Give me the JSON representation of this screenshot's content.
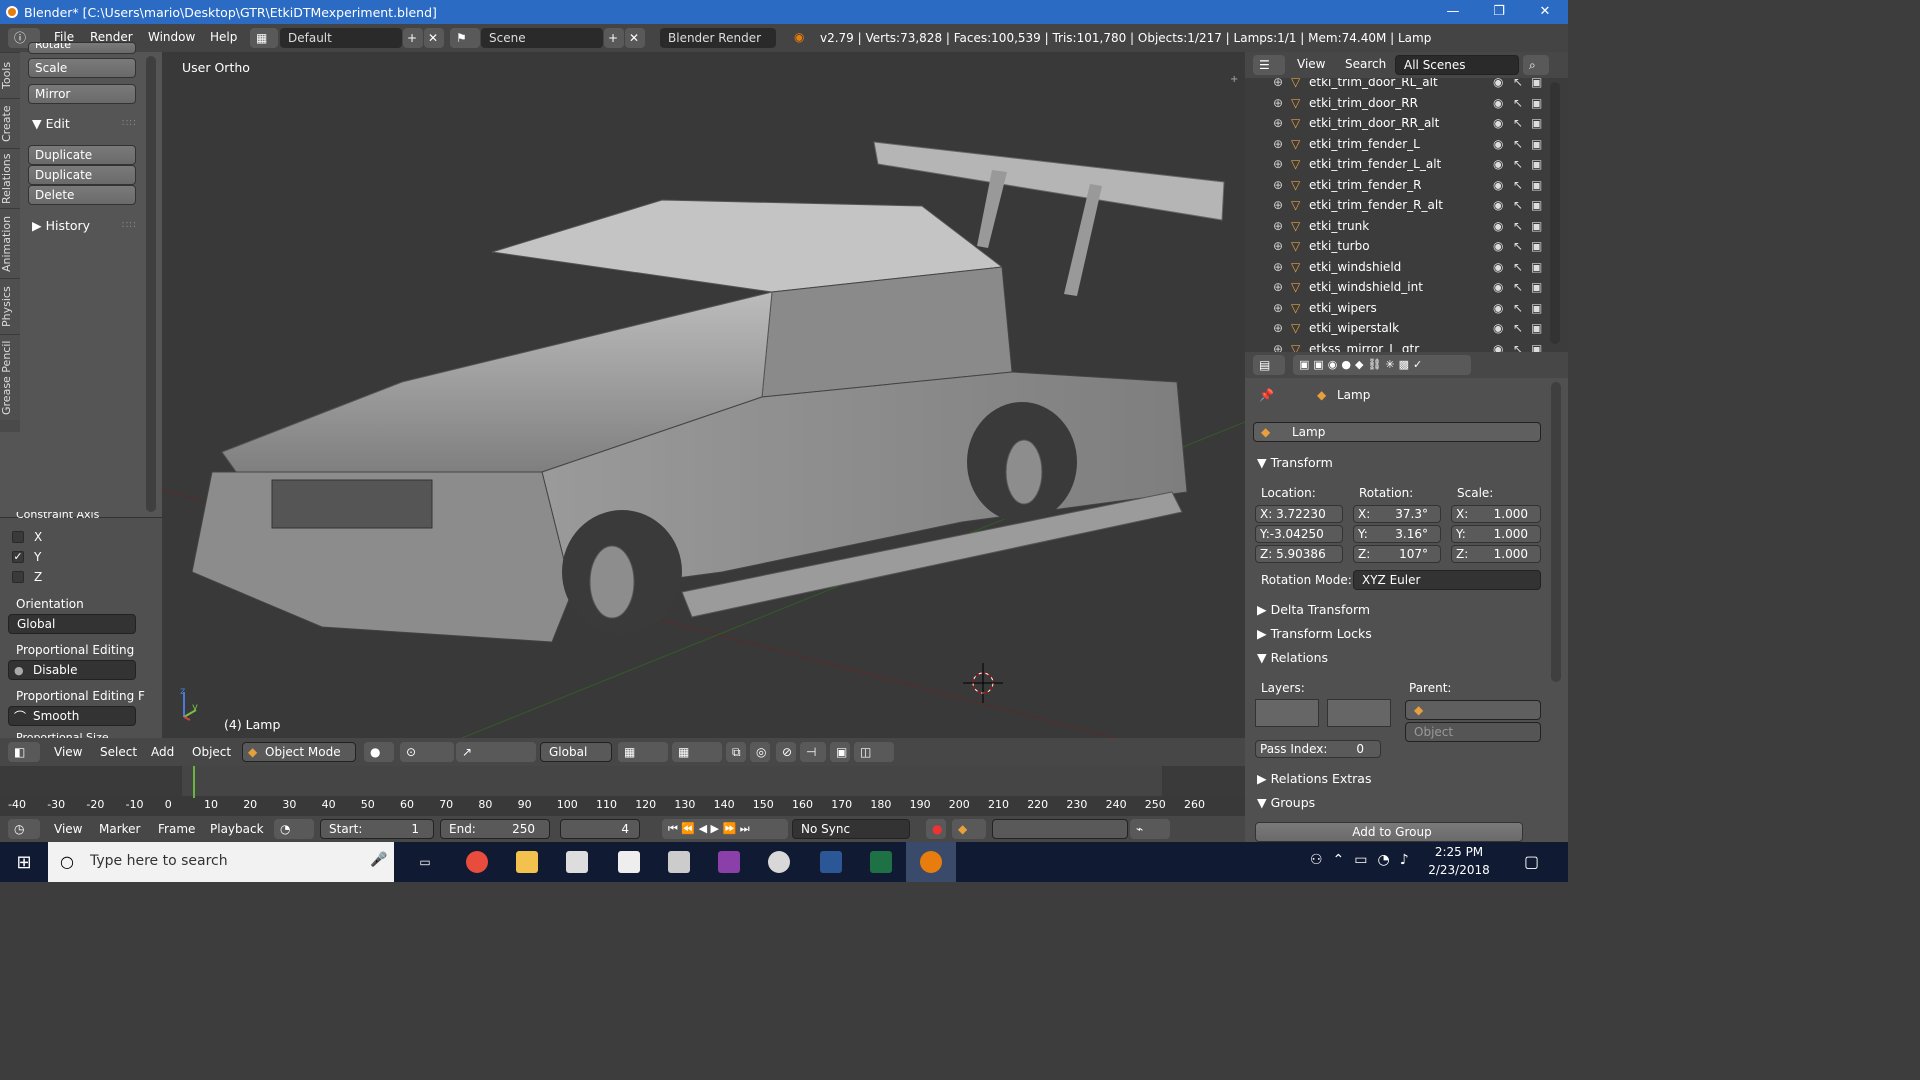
{
  "window": {
    "title": "Blender* [C:\\Users\\mario\\Desktop\\GTR\\EtkiDTMexperiment.blend]",
    "min": "—",
    "max": "❐",
    "close": "✕"
  },
  "menu": {
    "items": [
      "File",
      "Render",
      "Window",
      "Help"
    ],
    "screen_layout": "Default",
    "scene": "Scene",
    "engine": "Blender Render",
    "stats": "v2.79 | Verts:73,828 | Faces:100,539 | Tris:101,780 | Objects:1/217 | Lamps:1/1 | Mem:74.40M | Lamp"
  },
  "tabs": [
    "Tools",
    "Create",
    "Relations",
    "Animation",
    "Physics",
    "Grease Pencil"
  ],
  "tools": {
    "rotate": "Rotate",
    "scale": "Scale",
    "mirror": "Mirror",
    "edit_header": "Edit",
    "duplicate": "Duplicate",
    "duplicate_linked": "Duplicate Linked",
    "delete": "Delete",
    "history": "History"
  },
  "operator": {
    "constraint_axis": "Constraint Axis",
    "x": "X",
    "y": "Y",
    "z": "Z",
    "orientation_label": "Orientation",
    "orientation": "Global",
    "prop_edit_label": "Proportional Editing",
    "prop_edit": "Disable",
    "prop_falloff_label": "Proportional Editing F",
    "prop_falloff": "Smooth",
    "prop_size_label": "Proportional Size"
  },
  "viewport": {
    "view_name": "User Ortho",
    "object_label": "(4) Lamp",
    "axis_y": "y",
    "axis_z": "z"
  },
  "view_header": {
    "items": [
      "View",
      "Select",
      "Add",
      "Object"
    ],
    "mode": "Object Mode",
    "orientation": "Global"
  },
  "timeline": {
    "ticks": [
      "-40",
      "-30",
      "-20",
      "-10",
      "0",
      "10",
      "20",
      "30",
      "40",
      "50",
      "60",
      "70",
      "80",
      "90",
      "100",
      "110",
      "120",
      "130",
      "140",
      "150",
      "160",
      "170",
      "180",
      "190",
      "200",
      "210",
      "220",
      "230",
      "240",
      "250",
      "260"
    ],
    "menu": [
      "View",
      "Marker",
      "Frame",
      "Playback"
    ],
    "start_label": "Start:",
    "start": "1",
    "end_label": "End:",
    "end": "250",
    "current": "4",
    "sync": "No Sync"
  },
  "outliner": {
    "view": "View",
    "search": "Search",
    "scenes": "All Scenes",
    "rows": [
      "etki_trim_door_RL_alt",
      "etki_trim_door_RR",
      "etki_trim_door_RR_alt",
      "etki_trim_fender_L",
      "etki_trim_fender_L_alt",
      "etki_trim_fender_R",
      "etki_trim_fender_R_alt",
      "etki_trunk",
      "etki_turbo",
      "etki_windshield",
      "etki_windshield_int",
      "etki_wipers",
      "etki_wiperstalk",
      "etkss_mirror_L_gtr"
    ]
  },
  "properties": {
    "breadcrumb": "Lamp",
    "object_name": "Lamp",
    "transform": "Transform",
    "location_label": "Location:",
    "rotation_label": "Rotation:",
    "scale_label": "Scale:",
    "loc": [
      "X: 3.72230",
      "Y:-3.04250",
      "Z: 5.90386"
    ],
    "rot_labels": [
      "X:",
      "Y:",
      "Z:"
    ],
    "rot": [
      "37.3°",
      "3.16°",
      "107°"
    ],
    "scale_labels": [
      "X:",
      "Y:",
      "Z:"
    ],
    "scale": [
      "1.000",
      "1.000",
      "1.000"
    ],
    "rotation_mode_label": "Rotation Mode:",
    "rotation_mode": "XYZ Euler",
    "delta": "Delta Transform",
    "locks": "Transform Locks",
    "relations": "Relations",
    "layers_label": "Layers:",
    "parent_label": "Parent:",
    "parent_type": "Object",
    "pass_label": "Pass Index:",
    "pass": "0",
    "relations_extras": "Relations Extras",
    "groups": "Groups",
    "add_group": "Add to Group"
  },
  "taskbar": {
    "search": "Type here to search",
    "time": "2:25 PM",
    "date": "2/23/2018"
  }
}
